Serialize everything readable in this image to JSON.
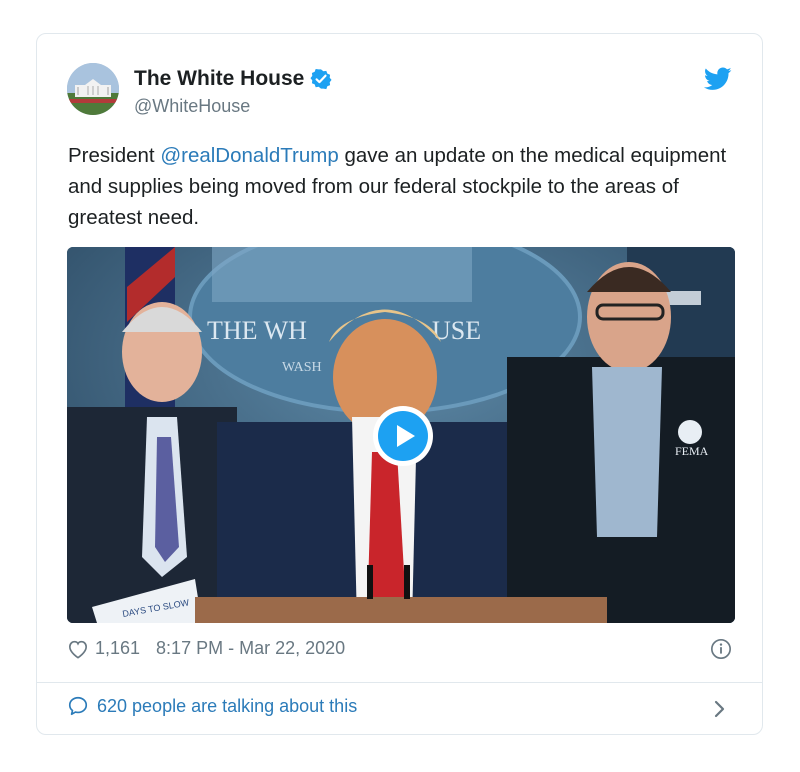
{
  "account": {
    "name": "The White House",
    "handle": "@WhiteHouse"
  },
  "tweet": {
    "text_before": "President ",
    "mention": "@realDonaldTrump",
    "text_after": " gave an update on the medical equipment and supplies being moved from our federal stockpile to the areas of greatest need."
  },
  "media": {
    "backdrop_text": "THE WH",
    "backdrop_text2": "USE",
    "backdrop_sub": "WASH",
    "badge": "FEMA",
    "paper_text": "DAYS TO SLOW"
  },
  "stats": {
    "likes": "1,161",
    "timestamp": "8:17 PM - Mar 22, 2020"
  },
  "footer": {
    "talking": "620 people are talking about this"
  },
  "colors": {
    "accent": "#1da1f2",
    "link": "#2b7bb9",
    "muted": "#697882",
    "border": "#e1e8ed"
  }
}
